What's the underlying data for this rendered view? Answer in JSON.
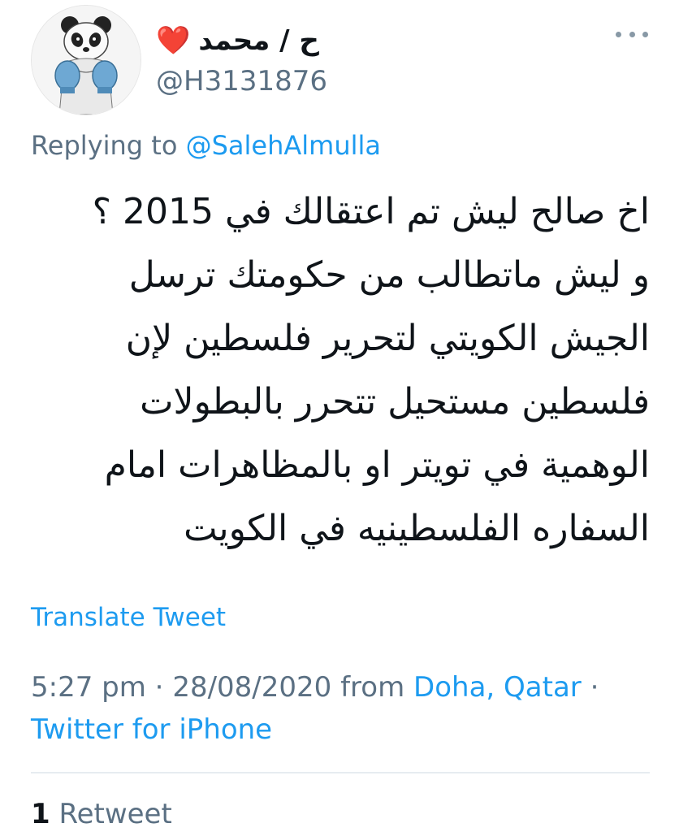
{
  "author": {
    "display_name": "ح / محمد",
    "heart": "❤️",
    "handle": "@H3131876",
    "avatar_icon": "panda-boxer-avatar"
  },
  "menu_icon": "more-options-icon",
  "reply": {
    "prefix": "Replying to ",
    "mention": "@SalehAlmulla"
  },
  "tweet": {
    "lines": [
      "اخ صالح ليش تم اعتقالك في 2015 ؟",
      "و ليش ماتطالب من حكومتك ترسل",
      "الجيش الكويتي لتحرير فلسطين لإن",
      "فلسطين مستحيل تتحرر بالبطولات",
      "الوهمية في تويتر او بالمظاهرات امام",
      "السفاره الفلسطينيه في الكويت"
    ]
  },
  "translate_label": "Translate Tweet",
  "meta": {
    "time": "5:27 pm",
    "sep1": " · ",
    "date": "28/08/2020",
    "from": " from ",
    "location": "Doha, Qatar",
    "sep2": " · ",
    "source": "Twitter for iPhone"
  },
  "stats": {
    "retweet_count": "1",
    "retweet_label": " Retweet"
  },
  "colors": {
    "link": "#1d9bf0",
    "secondary": "#5b7083",
    "heart": "#e0245e"
  }
}
